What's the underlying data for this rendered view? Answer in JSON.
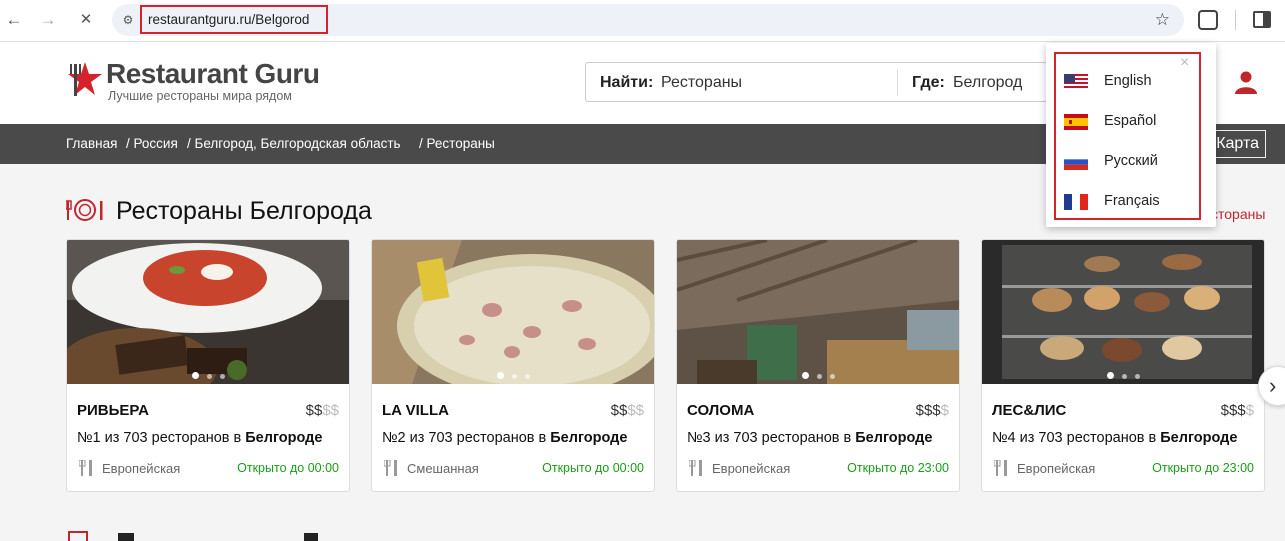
{
  "browser": {
    "url": "restaurantguru.ru/Belgorod",
    "back": "←",
    "forward": "→",
    "stop": "✕",
    "star": "☆"
  },
  "header": {
    "logo_title": "Restaurant Guru",
    "logo_tagline": "Лучшие рестораны мира рядом",
    "search_find_label": "Найти:",
    "search_find_value": "Рестораны",
    "search_where_label": "Где:",
    "search_where_value": "Белгород"
  },
  "breadcrumb": {
    "items": [
      "Главная",
      "/ Россия",
      "/ Белгород, Белгородская область",
      "/ Рестораны"
    ],
    "map_button": "Карта"
  },
  "section": {
    "title": "Рестораны Белгорода",
    "link_partial": "стораны"
  },
  "cards": [
    {
      "name": "РИВЬЕРА",
      "price_active": "$$",
      "price_dim": "$$",
      "rank_num": "№1",
      "rank_text": " из 703 ресторанов в ",
      "rank_city": "Белгороде",
      "cuisine": "Европейская",
      "open": "Открыто до 00:00"
    },
    {
      "name": "LA VILLA",
      "price_active": "$$",
      "price_dim": "$$",
      "rank_num": "№2",
      "rank_text": " из 703 ресторанов в ",
      "rank_city": "Белгороде",
      "cuisine": "Смешанная",
      "open": "Открыто до 00:00"
    },
    {
      "name": "СОЛОМА",
      "price_active": "$$$",
      "price_dim": "$",
      "rank_num": "№3",
      "rank_text": " из 703 ресторанов в ",
      "rank_city": "Белгороде",
      "cuisine": "Европейская",
      "open": "Открыто до 23:00"
    },
    {
      "name": "ЛЕС&ЛИС",
      "price_active": "$$$",
      "price_dim": "$",
      "rank_num": "№4",
      "rank_text": " из 703 ресторанов в ",
      "rank_city": "Белгороде",
      "cuisine": "Европейская",
      "open": "Открыто до 23:00"
    }
  ],
  "language_menu": {
    "close": "×",
    "items": [
      {
        "label": "English",
        "flag": "us-flag"
      },
      {
        "label": "Español",
        "flag": "es-flag"
      },
      {
        "label": "Русский",
        "flag": "ru-flag"
      },
      {
        "label": "Français",
        "flag": "fr-flag"
      }
    ]
  },
  "colors": {
    "brand_red": "#c0272d",
    "open_green": "#1a9c1a",
    "breadcrumb_bg": "#4a4a4a",
    "highlight_red": "#d4232b"
  }
}
